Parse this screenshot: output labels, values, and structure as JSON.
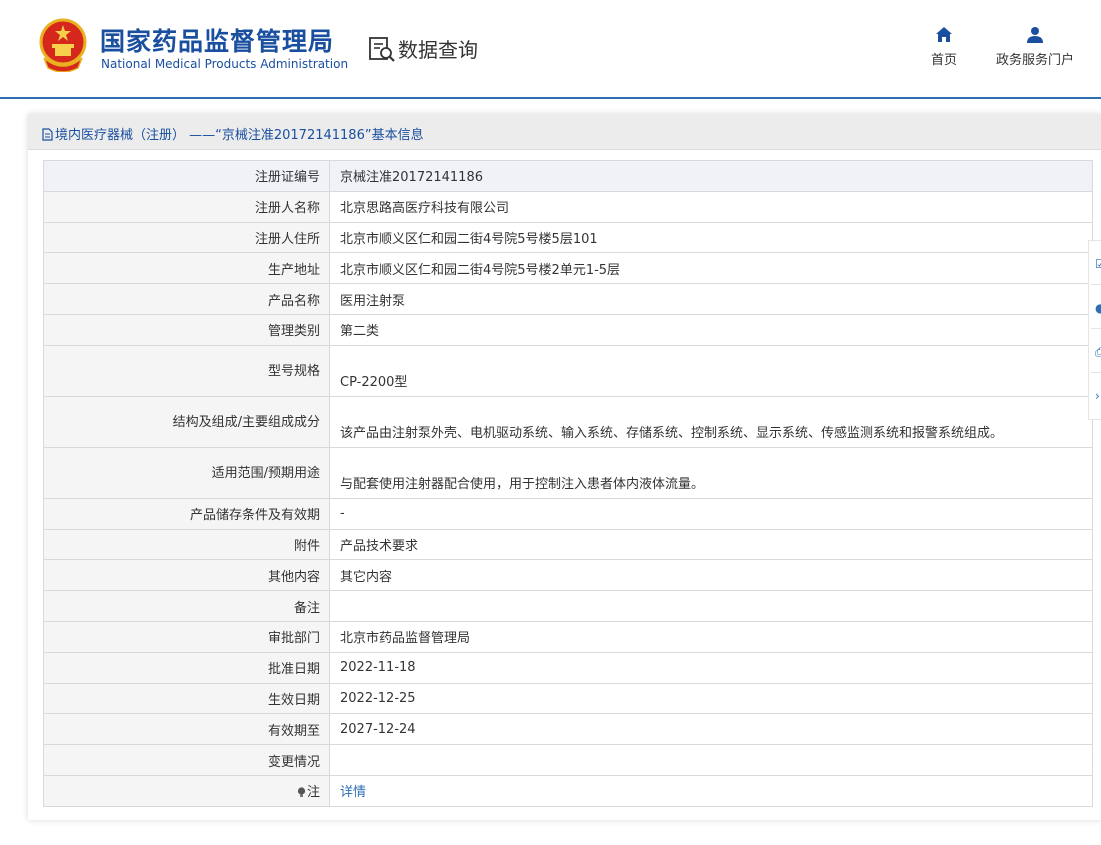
{
  "header": {
    "org_name_cn": "国家药品监督管理局",
    "org_name_en": "National Medical Products Administration",
    "query_title": "数据查询",
    "nav": [
      {
        "label": "首页",
        "icon": "home-icon"
      },
      {
        "label": "政务服务门户",
        "icon": "user-icon"
      }
    ]
  },
  "panel": {
    "title": "境内医疗器械（注册） ——“京械注准20172141186”基本信息"
  },
  "rows": [
    {
      "label": "注册证编号",
      "value": "京械注准20172141186"
    },
    {
      "label": "注册人名称",
      "value": "北京思路高医疗科技有限公司"
    },
    {
      "label": "注册人住所",
      "value": "北京市顺义区仁和园二街4号院5号楼5层101"
    },
    {
      "label": "生产地址",
      "value": "北京市顺义区仁和园二街4号院5号楼2单元1-5层"
    },
    {
      "label": "产品名称",
      "value": "医用注射泵"
    },
    {
      "label": "管理类别",
      "value": "第二类"
    },
    {
      "label": "型号规格",
      "value": "CP-2200型"
    },
    {
      "label": "结构及组成/主要组成成分",
      "value": "该产品由注射泵外壳、电机驱动系统、输入系统、存储系统、控制系统、显示系统、传感监测系统和报警系统组成。"
    },
    {
      "label": "适用范围/预期用途",
      "value": "与配套使用注射器配合使用，用于控制注入患者体内液体流量。"
    },
    {
      "label": "产品储存条件及有效期",
      "value": "-"
    },
    {
      "label": "附件",
      "value": "产品技术要求"
    },
    {
      "label": "其他内容",
      "value": "其它内容"
    },
    {
      "label": "备注",
      "value": ""
    },
    {
      "label": "审批部门",
      "value": "北京市药品监督管理局"
    },
    {
      "label": "批准日期",
      "value": "2022-11-18"
    },
    {
      "label": "生效日期",
      "value": "2022-12-25"
    },
    {
      "label": "有效期至",
      "value": "2027-12-24"
    },
    {
      "label": "变更情况",
      "value": ""
    },
    {
      "label": "注",
      "value": "详情"
    }
  ],
  "colors": {
    "brand_blue": "#1a4fa0",
    "link_blue": "#2e6fb4",
    "label_bg": "#f5f5f5"
  }
}
